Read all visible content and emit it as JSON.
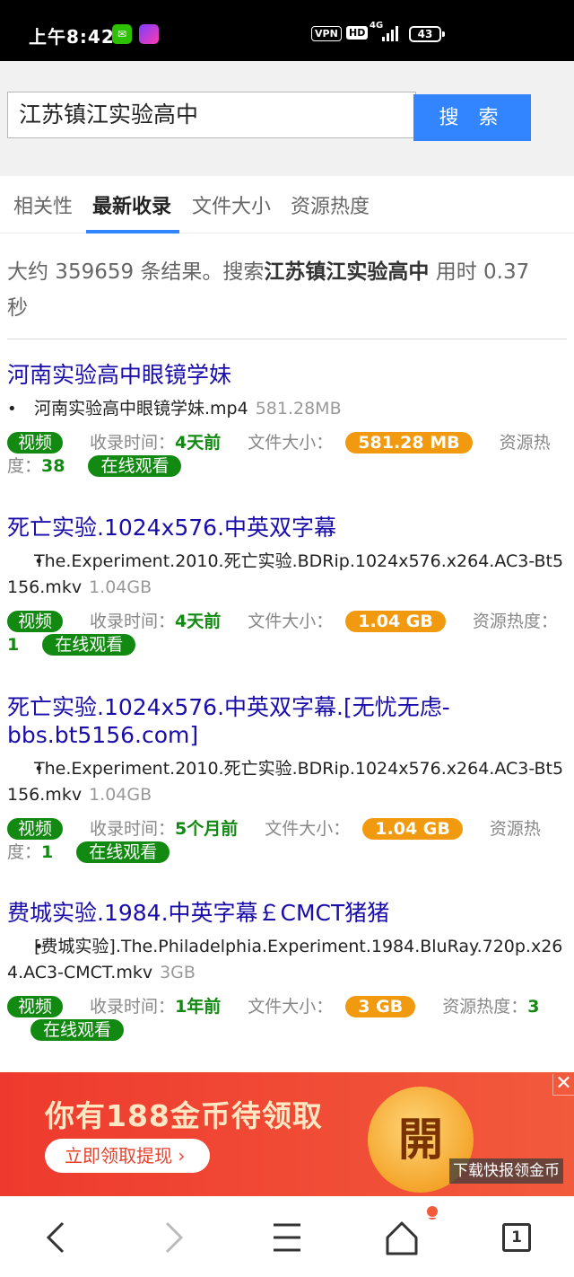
{
  "status_bar": {
    "time": "上午8:42",
    "vpn": "VPN",
    "hd": "HD",
    "network": "4G",
    "battery": "43"
  },
  "search": {
    "query": "江苏镇江实验高中",
    "button_label": "搜 索"
  },
  "tabs": [
    {
      "label": "相关性",
      "active": false
    },
    {
      "label": "最新收录",
      "active": true
    },
    {
      "label": "文件大小",
      "active": false
    },
    {
      "label": "资源热度",
      "active": false
    }
  ],
  "summary": {
    "prefix": "大约 359659 条结果。搜索",
    "query": "江苏镇江实验高中",
    "suffix": " 用时 0.37秒"
  },
  "meta_labels": {
    "type": "视频",
    "indexed": "收录时间：",
    "filesize": "文件大小：",
    "heat": "资源热度：",
    "watch": "在线观看"
  },
  "results": [
    {
      "title": "河南实验高中眼镜学妹",
      "filename": "河南实验高中眼镜学妹.mp4",
      "file_size": "581.28MB",
      "indexed": "4天前",
      "size_badge": "581.28 MB",
      "heat": "38"
    },
    {
      "title": "死亡实验.1024x576.中英双字幕",
      "filename": "The.Experiment.2010.死亡实验.BDRip.1024x576.x264.AC3-Bt5156.mkv",
      "file_size": "1.04GB",
      "indexed": "4天前",
      "size_badge": "1.04 GB",
      "heat": "1"
    },
    {
      "title": "死亡实验.1024x576.中英双字幕.[无忧无虑-bbs.bt5156.com]",
      "filename": "The.Experiment.2010.死亡实验.BDRip.1024x576.x264.AC3-Bt5156.mkv",
      "file_size": "1.04GB",
      "indexed": "5个月前",
      "size_badge": "1.04 GB",
      "heat": "1"
    },
    {
      "title": "费城实验.1984.中英字幕￡CMCT猪猪",
      "filename": "[费城实验].The.Philadelphia.Experiment.1984.BluRay.720p.x264.AC3-CMCT.mkv",
      "file_size": "3GB",
      "indexed": "1年前",
      "size_badge": "3 GB",
      "heat": "3"
    }
  ],
  "ad": {
    "headline": "你有188金币待领取",
    "button": "立即领取提现 ›",
    "coin_char": "開",
    "caption": "下载快报领金币",
    "close": "✕"
  },
  "bottom_nav": {
    "tab_count": "1"
  },
  "colors": {
    "link": "#1a0dab",
    "accent_blue": "#3385ff",
    "green": "#128a12",
    "orange": "#f29a0f",
    "ad_red": "#ee3a2e"
  }
}
